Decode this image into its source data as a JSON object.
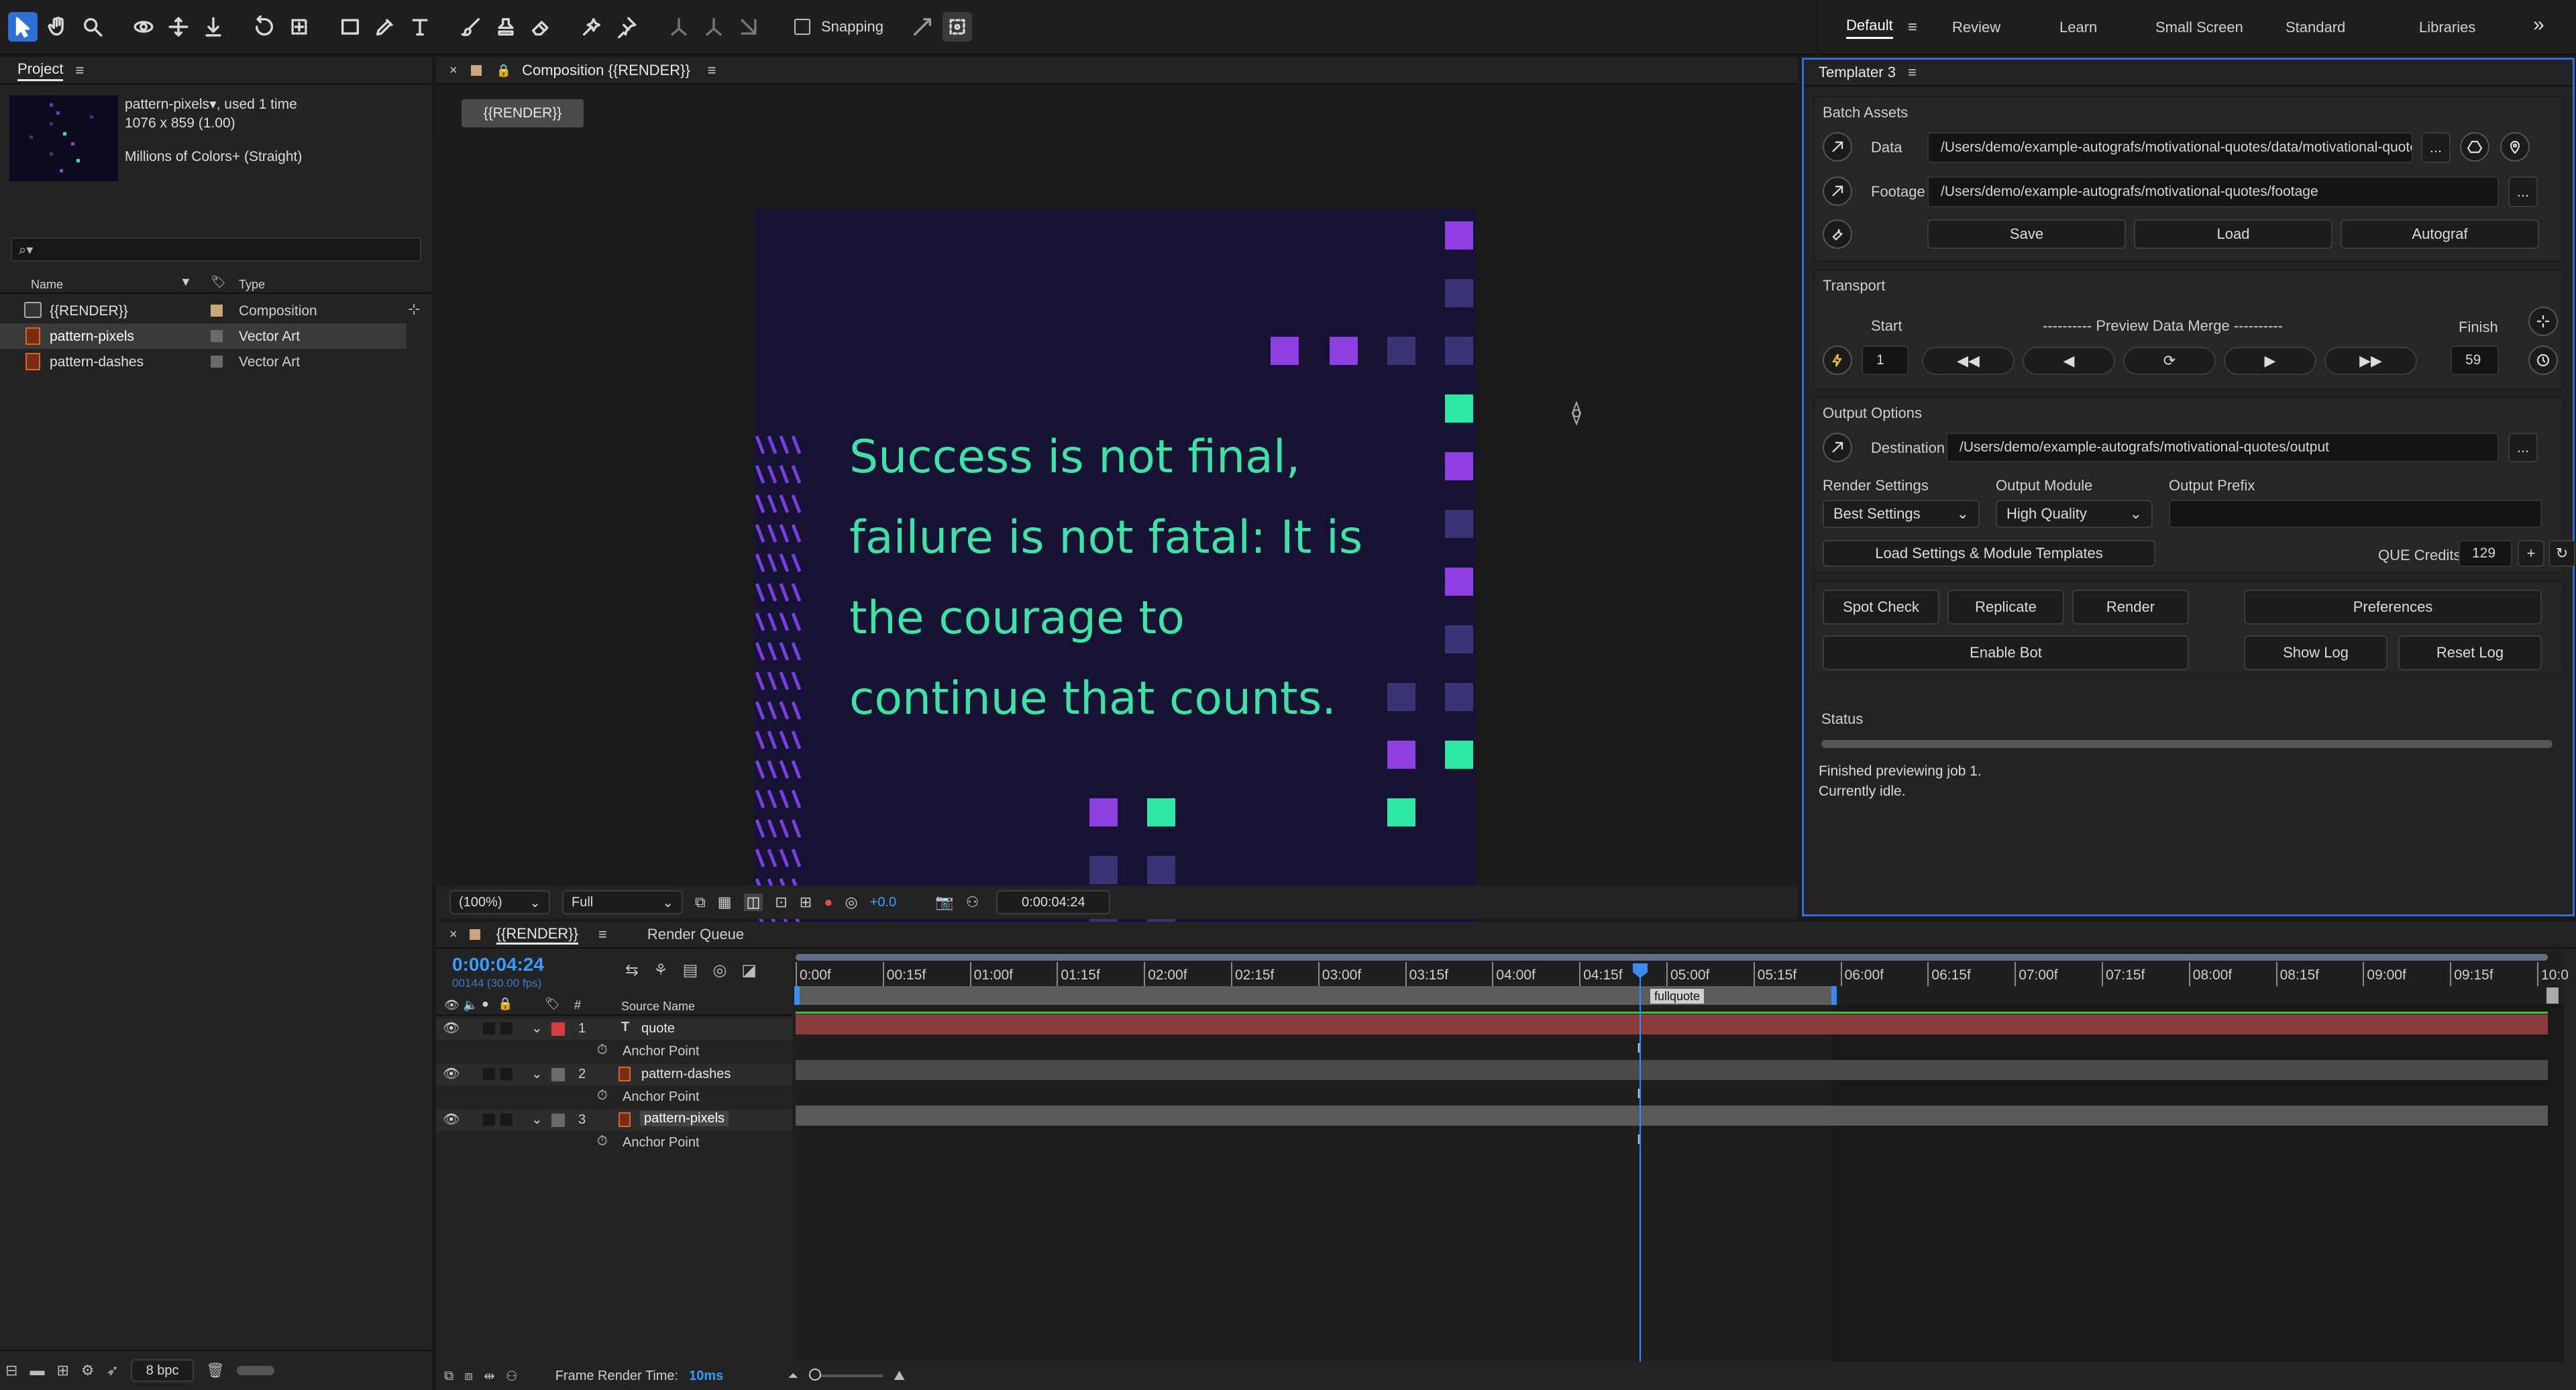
{
  "toolbar": {
    "snapping_label": "Snapping"
  },
  "workspaces": [
    "Default",
    "Review",
    "Learn",
    "Small Screen",
    "Standard",
    "Libraries"
  ],
  "project": {
    "panel_title": "Project",
    "item_name": "pattern-pixels",
    "item_used": ", used 1 time",
    "item_dims": "1076 x 859 (1.00)",
    "item_color": "Millions of Colors+ (Straight)",
    "col_name": "Name",
    "col_type": "Type",
    "rows": [
      {
        "name": "{{RENDER}}",
        "type": "Composition"
      },
      {
        "name": "pattern-pixels",
        "type": "Vector Art"
      },
      {
        "name": "pattern-dashes",
        "type": "Vector Art"
      }
    ],
    "bpc": "8 bpc"
  },
  "composition": {
    "panel_title": "Composition {{RENDER}}",
    "tab": "{{RENDER}}",
    "quote": [
      "Success is not final,",
      "failure is not fatal: It is",
      "the courage to",
      "continue that counts."
    ],
    "zoom": "(100%)",
    "resolution": "Full",
    "exposure": "+0.0",
    "timecode": "0:00:04:24"
  },
  "templater": {
    "panel_title": "Templater 3",
    "batch_assets": "Batch Assets",
    "data_label": "Data",
    "data_path": "/Users/demo/example-autografs/motivational-quotes/data/motivational-quotes",
    "footage_label": "Footage",
    "footage_path": "/Users/demo/example-autografs/motivational-quotes/footage",
    "save": "Save",
    "load": "Load",
    "autograf": "Autograf",
    "transport": "Transport",
    "start_label": "Start",
    "preview_label": "---------- Preview Data Merge ----------",
    "finish_label": "Finish",
    "start_value": "1",
    "finish_value": "59",
    "output_options": "Output Options",
    "destination_label": "Destination",
    "destination_path": "/Users/demo/example-autografs/motivational-quotes/output",
    "render_settings_label": "Render Settings",
    "output_module_label": "Output Module",
    "output_prefix_label": "Output Prefix",
    "render_settings_value": "Best Settings",
    "output_module_value": "High Quality",
    "load_templates": "Load Settings & Module Templates",
    "que_credits_label": "QUE Credits",
    "que_credits_value": "129",
    "spot_check": "Spot Check",
    "replicate": "Replicate",
    "render": "Render",
    "preferences": "Preferences",
    "enable_bot": "Enable Bot",
    "show_log": "Show Log",
    "reset_log": "Reset Log",
    "status_label": "Status",
    "status_line1": "Finished previewing job 1.",
    "status_line2": "Currently idle."
  },
  "timeline": {
    "tab": "{{RENDER}}",
    "render_queue": "Render Queue",
    "timecode": "0:00:04:24",
    "frames": "00144 (30.00 fps)",
    "col_num": "#",
    "col_source": "Source Name",
    "ticks": [
      "0:00f",
      "00:15f",
      "01:00f",
      "01:15f",
      "02:00f",
      "02:15f",
      "03:00f",
      "03:15f",
      "04:00f",
      "04:15f",
      "05:00f",
      "05:15f",
      "06:00f",
      "06:15f",
      "07:00f",
      "07:15f",
      "08:00f",
      "08:15f",
      "09:00f",
      "09:15f",
      "10:0"
    ],
    "marker_label": "fullquote",
    "layers": [
      {
        "num": "1",
        "name": "quote",
        "prop": "Anchor Point"
      },
      {
        "num": "2",
        "name": "pattern-dashes",
        "prop": "Anchor Point"
      },
      {
        "num": "3",
        "name": "pattern-pixels",
        "prop": "Anchor Point"
      }
    ],
    "frame_render_label": "Frame Render Time:",
    "frame_render_value": "10ms"
  },
  "colors": {
    "accent": "#2d8ceb",
    "comp_bg": "#161233",
    "quote_text": "#3ee2a6",
    "purple": "#8f3ee0",
    "dim_square": "#3a3475",
    "teal": "#2ee8a4",
    "red_layer": "#8a3b3b",
    "green_line": "#3ec83e"
  }
}
